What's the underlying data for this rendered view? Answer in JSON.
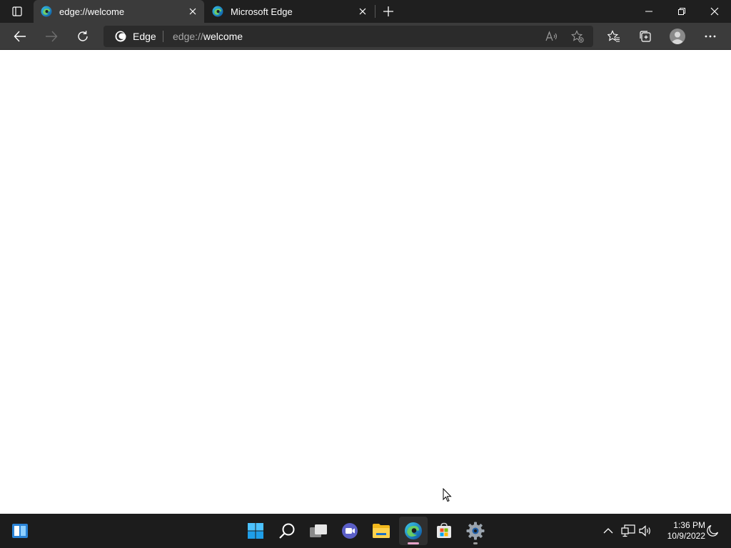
{
  "browser": {
    "tabs": [
      {
        "title": "edge://welcome",
        "active": true
      },
      {
        "title": "Microsoft Edge",
        "active": false
      }
    ],
    "address": {
      "brand": "Edge",
      "url_scheme": "edge://",
      "url_rest": "welcome"
    },
    "icons": {
      "tab_actions": "tab-actions-icon",
      "back": "arrow-left-icon",
      "forward": "arrow-right-icon",
      "refresh": "refresh-icon",
      "read_aloud": "read-aloud-icon",
      "add_favorite": "star-add-icon",
      "favorites": "favorites-icon",
      "collections": "collections-icon",
      "profile": "profile-avatar-icon",
      "more": "more-dots-icon"
    },
    "colors": {
      "titlebar": "#1f1f1f",
      "toolbar": "#3b3b3b",
      "addressbar": "#2b2b2b",
      "taskbar": "#1c1c1c",
      "edge_indicator": "#e6a3c9"
    }
  },
  "taskbar": {
    "apps": [
      {
        "name": "widgets-icon"
      },
      {
        "name": "start-icon"
      },
      {
        "name": "search-icon"
      },
      {
        "name": "task-view-icon"
      },
      {
        "name": "chat-icon"
      },
      {
        "name": "file-explorer-icon"
      },
      {
        "name": "edge-icon",
        "active": true
      },
      {
        "name": "store-icon"
      },
      {
        "name": "settings-icon"
      }
    ],
    "clock": {
      "time": "1:36 PM",
      "date": "10/9/2022"
    }
  }
}
